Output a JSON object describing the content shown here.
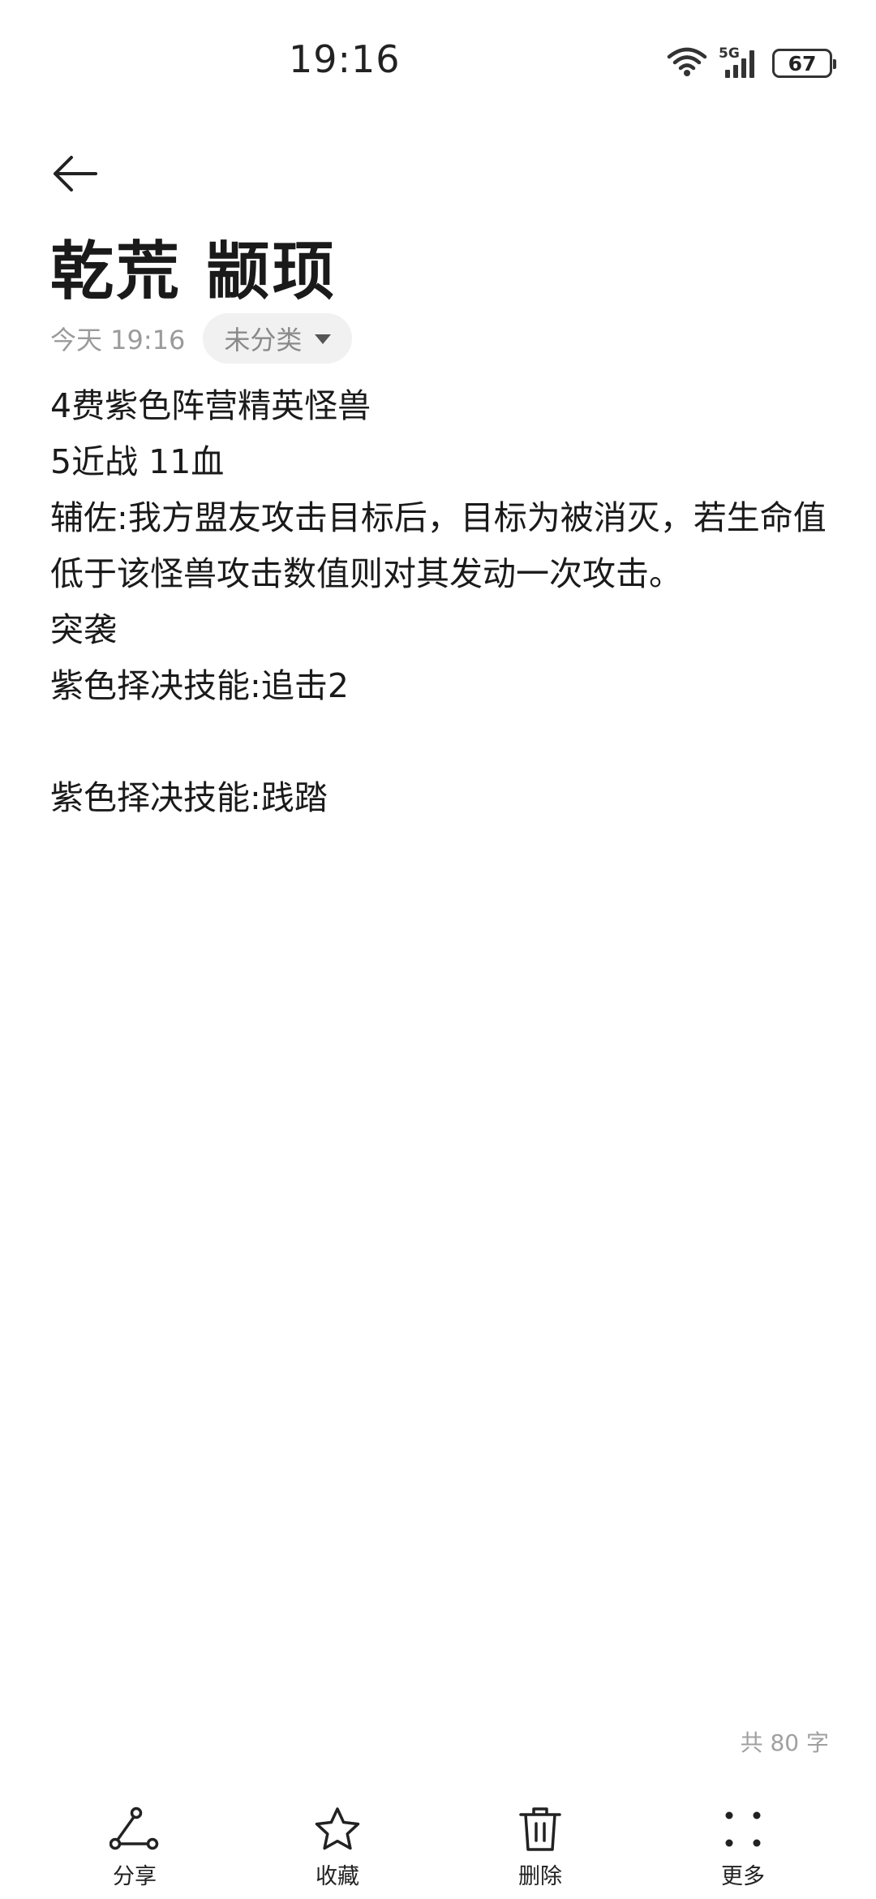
{
  "status_bar": {
    "time": "19:16",
    "network": "5G",
    "battery": "67",
    "icons": [
      "wifi-icon",
      "cellular-signal-icon",
      "battery-icon"
    ]
  },
  "header": {
    "back_icon": "back-arrow-icon"
  },
  "note": {
    "title": "乾荒 颛顼",
    "date": "今天 19:16",
    "category": "未分类",
    "lines": [
      "4费紫色阵营精英怪兽",
      "5近战 11血",
      "辅佐:我方盟友攻击目标后，目标为被消灭，若生命值低于该怪兽攻击数值则对其发动一次攻击。",
      "突袭",
      "紫色择决技能:追击2",
      "",
      "紫色择决技能:践踏"
    ],
    "word_count": "共 80 字"
  },
  "toolbar": {
    "share_label": "分享",
    "favorite_label": "收藏",
    "delete_label": "删除",
    "more_label": "更多"
  }
}
